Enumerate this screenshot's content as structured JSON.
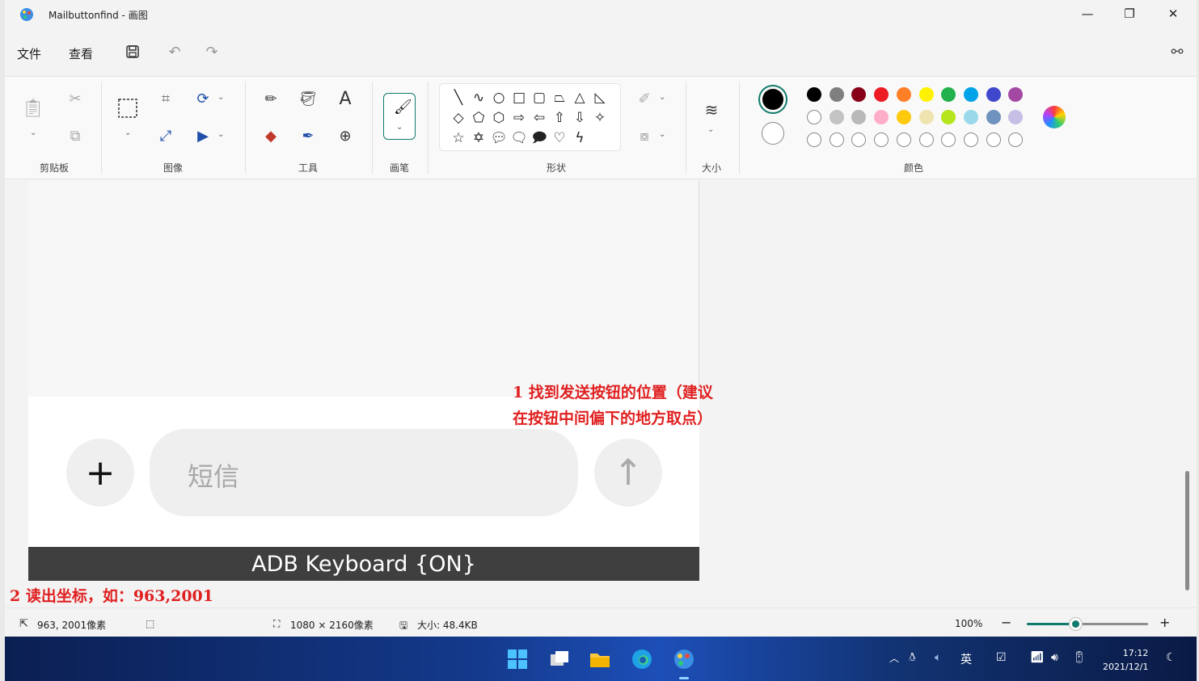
{
  "window": {
    "title": "Mailbuttonfind - 画图"
  },
  "menu": {
    "file": "文件",
    "view": "查看"
  },
  "ribbon": {
    "groups": {
      "clipboard": "剪贴板",
      "image": "图像",
      "tools": "工具",
      "brushes": "画笔",
      "shapes": "形状",
      "size": "大小",
      "colors": "颜色"
    },
    "text_tool": "A"
  },
  "colors": {
    "primary": "#000000",
    "secondary": "#ffffff",
    "row1": [
      "#000000",
      "#7f7f7f",
      "#880015",
      "#ed1c24",
      "#ff7f27",
      "#fff200",
      "#22b14c",
      "#00a2e8",
      "#3f48cc",
      "#a349a4"
    ],
    "row2": [
      "#ffffff",
      "#c3c3c3",
      "#b9b9b9",
      "#ffaec9",
      "#ffc90e",
      "#efe4b0",
      "#b5e61d",
      "#99d9ea",
      "#7092be",
      "#c8bfe7"
    ],
    "accent": "#0f7b6a"
  },
  "canvas": {
    "sms_placeholder": "短信",
    "plus_symbol": "+",
    "send_symbol": "↑",
    "adb_banner": "ADB Keyboard {ON}",
    "annotation1_line1": "1 找到发送按钮的位置（建议",
    "annotation1_line2": "在按钮中间偏下的地方取点）",
    "annotation2": "2 读出坐标，如：963,2001"
  },
  "status": {
    "cursor_pos": "963, 2001像素",
    "dimensions": "1080 × 2160像素",
    "file_size": "大小: 48.4KB",
    "zoom": "100%",
    "zoom_minus": "−",
    "zoom_plus": "+",
    "zoom_level": 0.4
  },
  "taskbar": {
    "ime": "英",
    "time": "17:12",
    "date": "2021/12/1"
  }
}
